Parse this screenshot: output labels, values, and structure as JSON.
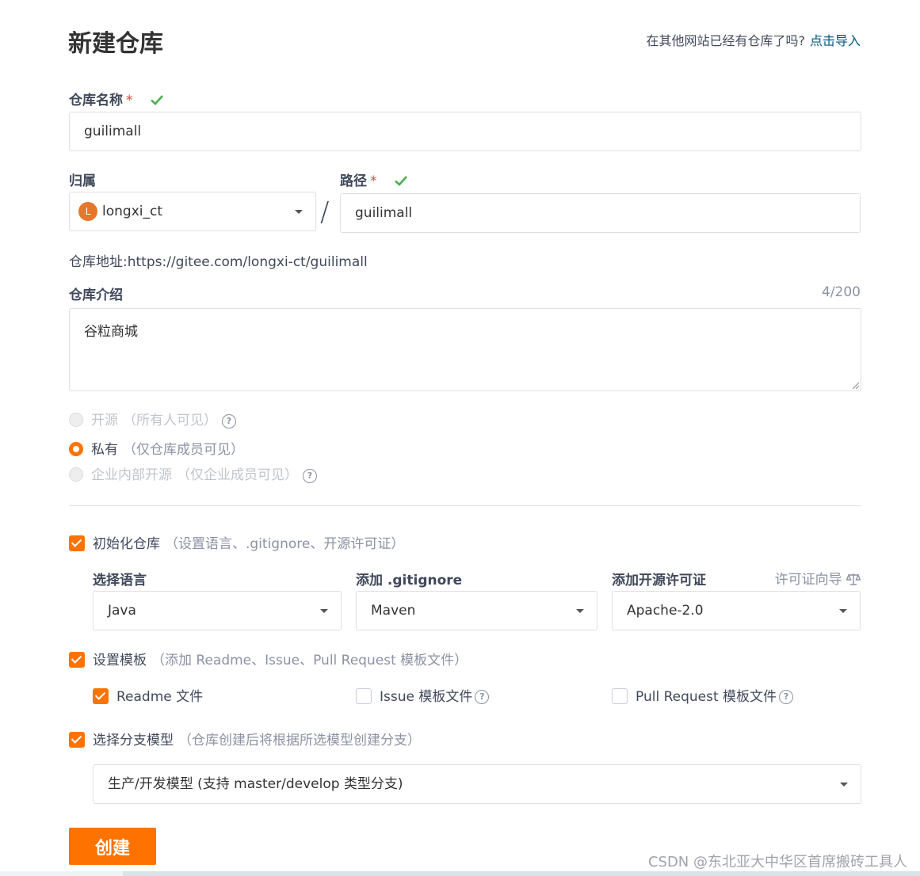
{
  "header": {
    "title": "新建仓库",
    "import_hint": "在其他网站已经有仓库了吗?",
    "import_link": "点击导入"
  },
  "repo_name": {
    "label": "仓库名称",
    "required_mark": "*",
    "value": "guilimall"
  },
  "owner": {
    "label": "归属",
    "avatar_letter": "L",
    "value": "longxi_ct",
    "separator": "/"
  },
  "path": {
    "label": "路径",
    "required_mark": "*",
    "value": "guilimall"
  },
  "repo_url": {
    "label": "仓库地址:",
    "value": "https://gitee.com/longxi-ct/guilimall"
  },
  "description": {
    "label": "仓库介绍",
    "counter": "4/200",
    "value": "谷粒商城"
  },
  "visibility": {
    "options": [
      {
        "label": "开源",
        "sub": "（所有人可见）",
        "selected": false,
        "disabled": true,
        "help": true
      },
      {
        "label": "私有",
        "sub": "（仅仓库成员可见）",
        "selected": true,
        "disabled": false,
        "help": false
      },
      {
        "label": "企业内部开源",
        "sub": "（仅企业成员可见）",
        "selected": false,
        "disabled": true,
        "help": true
      }
    ]
  },
  "init_repo": {
    "checked": true,
    "label": "初始化仓库",
    "sub": "（设置语言、.gitignore、开源许可证）",
    "language": {
      "label": "选择语言",
      "value": "Java"
    },
    "gitignore": {
      "label": "添加 .gitignore",
      "value": "Maven"
    },
    "license": {
      "label": "添加开源许可证",
      "value": "Apache-2.0",
      "guide": "许可证向导"
    }
  },
  "template": {
    "checked": true,
    "label": "设置模板",
    "sub": "（添加 Readme、Issue、Pull Request 模板文件）",
    "items": [
      {
        "label": "Readme 文件",
        "checked": true,
        "help": false
      },
      {
        "label": "Issue 模板文件",
        "checked": false,
        "help": true
      },
      {
        "label": "Pull Request 模板文件",
        "checked": false,
        "help": true
      }
    ]
  },
  "branch_model": {
    "checked": true,
    "label": "选择分支模型",
    "sub": "（仓库创建后将根据所选模型创建分支）",
    "value": "生产/开发模型 (支持 master/develop 类型分支)"
  },
  "actions": {
    "create_label": "创建"
  },
  "watermark": "CSDN @东北亚大中华区首席搬砖工具人",
  "colors": {
    "accent": "#fe7300",
    "link": "#005980",
    "success": "#4caf50",
    "required": "#e53f3f"
  },
  "icons": {
    "valid": "check-icon",
    "help": "question-circle-icon",
    "dropdown": "caret-down-icon",
    "license_guide": "scale-icon"
  }
}
